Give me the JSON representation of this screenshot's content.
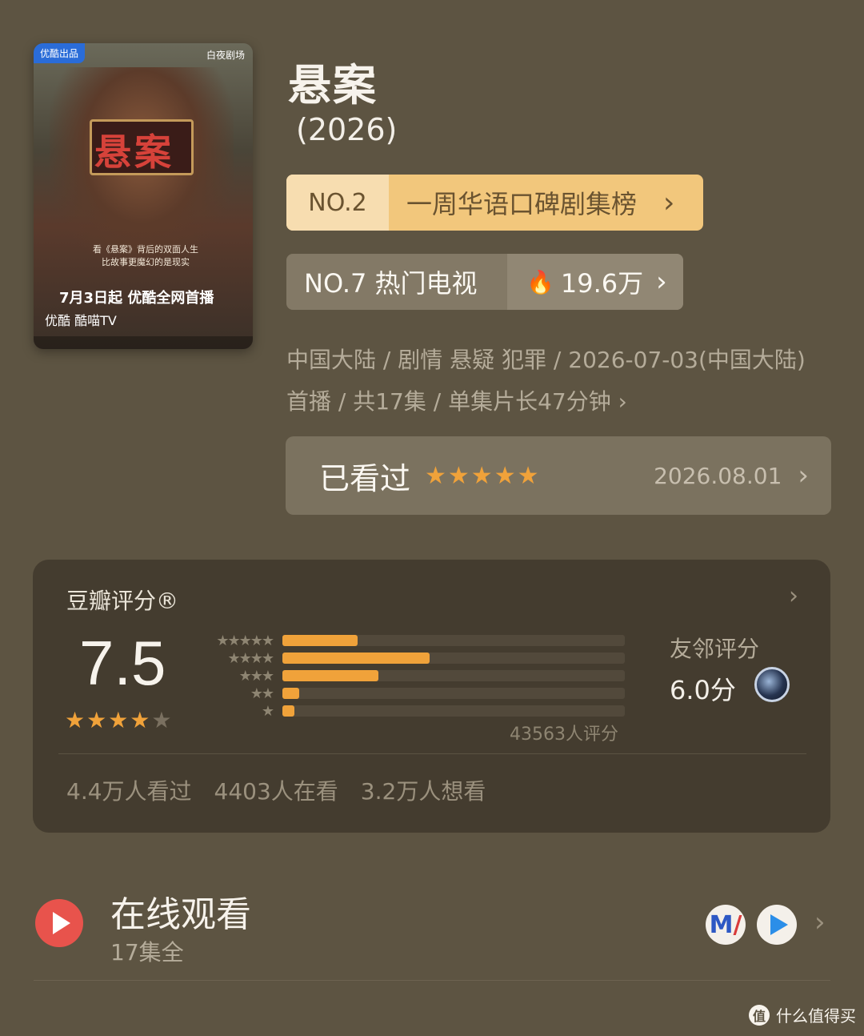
{
  "poster": {
    "tag_left": "优酷出品",
    "tag_right": "白夜剧场",
    "title": "悬案",
    "tagline_1": "看《悬案》背后的双面人生",
    "tagline_2": "比故事更魔幻的是现实",
    "air_date": "7月3日起 优酷全网首播",
    "platforms": "优酷  酷喵TV"
  },
  "show": {
    "title": "悬案",
    "year": "(2026)"
  },
  "rank_primary": {
    "number": "NO.2",
    "list": "一周华语口碑剧集榜",
    "chevron": "›"
  },
  "rank_secondary": {
    "label": "NO.7 热门电视",
    "fire_icon": "flame-icon",
    "heat": "19.6万",
    "chevron": "›"
  },
  "meta": {
    "text": "中国大陆 / 剧情 悬疑 犯罪 / 2026-07-03(中国大陆) 首播 / 共17集 / 单集片长47分钟 ›"
  },
  "watched": {
    "label": "已看过",
    "stars": "★★★★★",
    "date": "2026.08.01",
    "chevron": "›"
  },
  "douban": {
    "label": "豆瓣评分®",
    "chevron": "›",
    "score": "7.5",
    "stars_on": "★★★★",
    "stars_off": "★",
    "distribution": [
      {
        "stars": "★★★★★",
        "fraction": 0.22
      },
      {
        "stars": "★★★★",
        "fraction": 0.43
      },
      {
        "stars": "★★★",
        "fraction": 0.28
      },
      {
        "stars": "★★",
        "fraction": 0.05
      },
      {
        "stars": "★",
        "fraction": 0.035
      }
    ],
    "votes": "43563人评分",
    "friend_label": "友邻评分",
    "friend_score": "6.0分",
    "stats": {
      "watched": "4.4万人看过",
      "watching": "4403人在看",
      "want": "3.2万人想看"
    }
  },
  "online": {
    "title": "在线观看",
    "subtitle": "17集全",
    "chevron": "›"
  },
  "watermark": {
    "text": "什么值得买",
    "logo": "值"
  },
  "colors": {
    "background": "#5d5442",
    "accent_orange": "#f0a23a",
    "rank_gold": "#f2c77c"
  }
}
